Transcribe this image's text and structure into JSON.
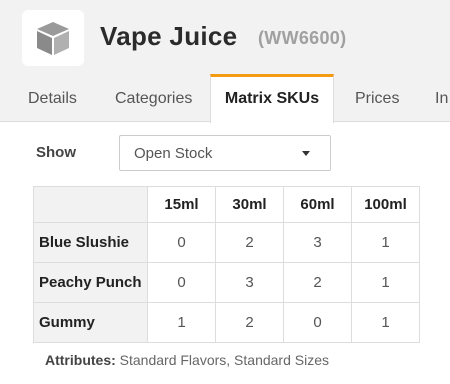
{
  "header": {
    "logo_icon": "box-icon",
    "title": "Vape Juice",
    "code": "(WW6600)"
  },
  "tabs": [
    {
      "label": "Details",
      "active": false
    },
    {
      "label": "Categories",
      "active": false
    },
    {
      "label": "Matrix SKUs",
      "active": true
    },
    {
      "label": "Prices",
      "active": false
    },
    {
      "label": "In",
      "active": false
    }
  ],
  "filter": {
    "label": "Show",
    "selected": "Open Stock"
  },
  "matrix": {
    "columns": [
      "15ml",
      "30ml",
      "60ml",
      "100ml"
    ],
    "rows": [
      {
        "name": "Blue Slushie",
        "values": [
          "0",
          "2",
          "3",
          "1"
        ]
      },
      {
        "name": "Peachy Punch",
        "values": [
          "0",
          "3",
          "2",
          "1"
        ]
      },
      {
        "name": "Gummy",
        "values": [
          "1",
          "2",
          "0",
          "1"
        ]
      }
    ]
  },
  "attributes": {
    "label": "Attributes:",
    "value": "Standard Flavors, Standard Sizes"
  },
  "colors": {
    "accent": "#f39c12",
    "header_bg": "#f2f2f2"
  }
}
